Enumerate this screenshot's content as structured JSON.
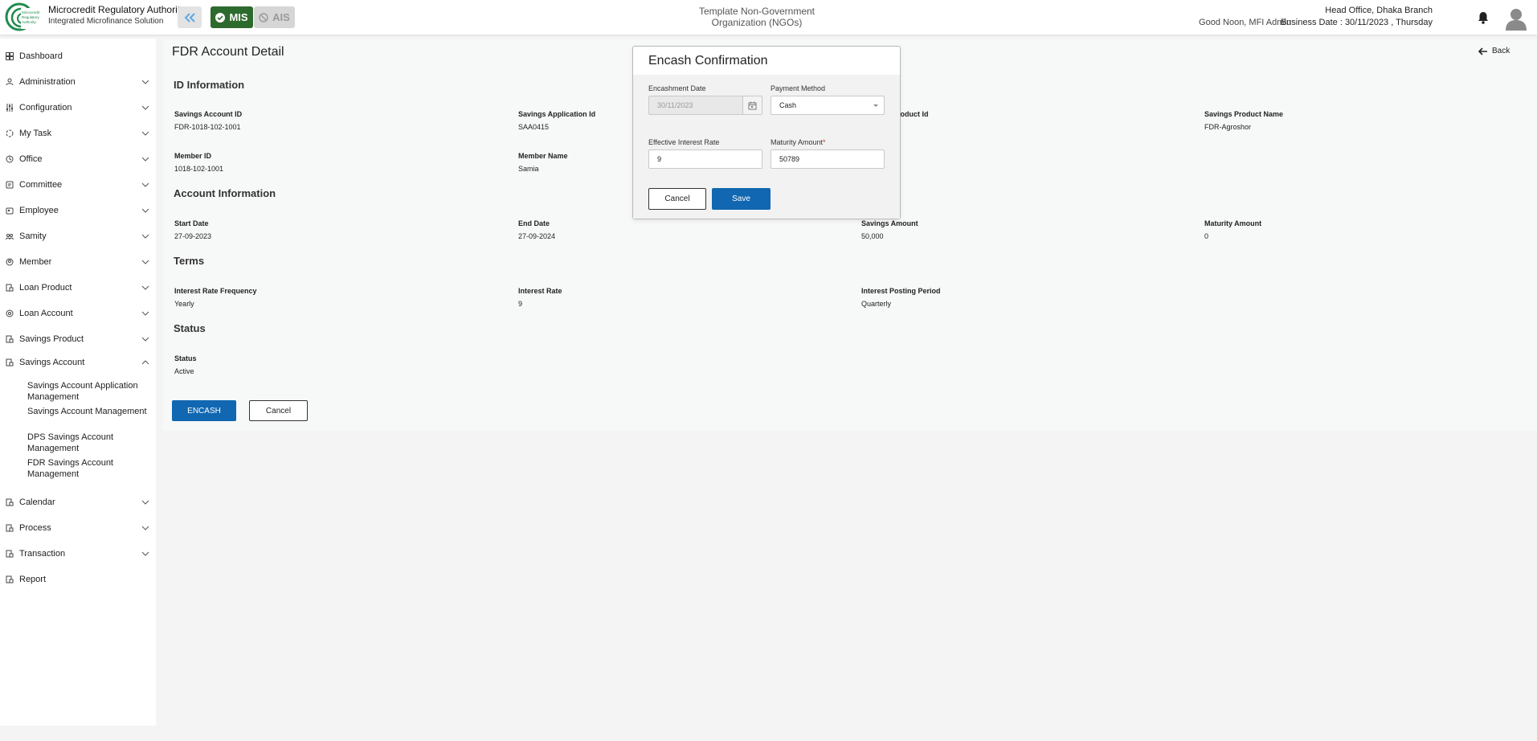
{
  "header": {
    "org_name": "Microcredit Regulatory Authority",
    "org_sub": "Integrated Microfinance Solution",
    "logo_text": "Microcredit Regulatory Authority",
    "mis_label": "MIS",
    "ais_label": "AIS",
    "center_title_line1": "Template Non-Government",
    "center_title_line2": "Organization (NGOs)",
    "greeting": "Good Noon, MFI Admin",
    "branch": "Head Office, Dhaka Branch",
    "business_date": "Business Date : 30/11/2023 , Thursday"
  },
  "sidebar": {
    "items": [
      {
        "label": "Dashboard",
        "icon": "dashboard-icon",
        "has_chevron": false
      },
      {
        "label": "Administration",
        "icon": "admin-icon",
        "has_chevron": true
      },
      {
        "label": "Configuration",
        "icon": "sliders-icon",
        "has_chevron": true
      },
      {
        "label": "My Task",
        "icon": "task-icon",
        "has_chevron": true
      },
      {
        "label": "Office",
        "icon": "office-icon",
        "has_chevron": true
      },
      {
        "label": "Committee",
        "icon": "committee-icon",
        "has_chevron": true
      },
      {
        "label": "Employee",
        "icon": "employee-icon",
        "has_chevron": true
      },
      {
        "label": "Samity",
        "icon": "samity-icon",
        "has_chevron": true
      },
      {
        "label": "Member",
        "icon": "member-icon",
        "has_chevron": true
      },
      {
        "label": "Loan Product",
        "icon": "loan-product-icon",
        "has_chevron": true
      },
      {
        "label": "Loan Account",
        "icon": "loan-account-icon",
        "has_chevron": true
      },
      {
        "label": "Savings Product",
        "icon": "savings-product-icon",
        "has_chevron": true
      },
      {
        "label": "Savings Account",
        "icon": "savings-account-icon",
        "has_chevron": true,
        "expanded": true
      }
    ],
    "sub_items": [
      "Savings Account Application Management",
      "Savings Account Management",
      "DPS Savings Account Management",
      "FDR Savings Account Management"
    ],
    "items_after": [
      {
        "label": "Calendar",
        "icon": "calendar-icon",
        "has_chevron": true
      },
      {
        "label": "Process",
        "icon": "process-icon",
        "has_chevron": true
      },
      {
        "label": "Transaction",
        "icon": "transaction-icon",
        "has_chevron": true
      },
      {
        "label": "Report",
        "icon": "report-icon",
        "has_chevron": false
      }
    ]
  },
  "main": {
    "page_title": "FDR Account Detail",
    "back_label": "Back",
    "sections": {
      "id_info": "ID Information",
      "account_info": "Account Information",
      "terms": "Terms",
      "status": "Status"
    },
    "id_info": {
      "savings_account_id_label": "Savings Account ID",
      "savings_account_id": "FDR-1018-102-1001",
      "savings_application_id_label": "Savings Application Id",
      "savings_application_id": "SAA0415",
      "savings_product_id_label_partial": "roduct Id",
      "savings_product_name_label": "Savings Product Name",
      "savings_product_name": "FDR-Agroshor",
      "member_id_label": "Member ID",
      "member_id": "1018-102-1001",
      "member_name_label": "Member Name",
      "member_name": "Samia"
    },
    "account_info": {
      "start_date_label": "Start Date",
      "start_date": "27-09-2023",
      "end_date_label": "End Date",
      "end_date": "27-09-2024",
      "savings_amount_label": "Savings Amount",
      "savings_amount": "50,000",
      "maturity_amount_label": "Maturity Amount",
      "maturity_amount": "0"
    },
    "terms": {
      "interest_rate_frequency_label": "Interest Rate Frequency",
      "interest_rate_frequency": "Yearly",
      "interest_rate_label": "Interest Rate",
      "interest_rate": "9",
      "interest_posting_period_label": "Interest Posting Period",
      "interest_posting_period": "Quarterly"
    },
    "status": {
      "status_label": "Status",
      "status_value": "Active"
    },
    "encash_label": "ENCASH",
    "cancel_label": "Cancel"
  },
  "modal": {
    "title": "Encash Confirmation",
    "encashment_date_label": "Encashment Date",
    "encashment_date_value": "30/11/2023",
    "payment_method_label": "Payment Method",
    "payment_method_value": "Cash",
    "effective_interest_rate_label": "Effective Interest Rate",
    "effective_interest_rate_value": "9",
    "maturity_amount_label": "Maturity Amount",
    "maturity_amount_required": "*",
    "maturity_amount_value": "50789",
    "cancel_label": "Cancel",
    "save_label": "Save"
  },
  "colors": {
    "primary_blue": "#1167b1",
    "mis_green": "#2d6a2d",
    "logo_green": "#1f8a4c"
  }
}
